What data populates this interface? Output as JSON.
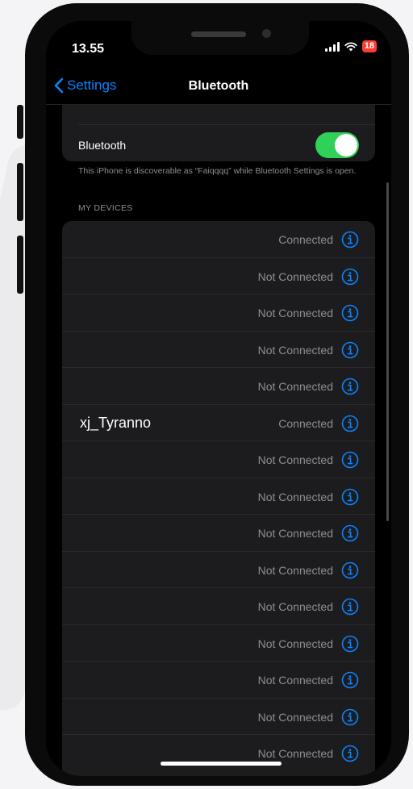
{
  "status_bar": {
    "time": "13.55",
    "battery_level": "18",
    "icons": [
      "signal-icon",
      "wifi-icon",
      "battery-icon"
    ]
  },
  "nav": {
    "back_label": "Settings",
    "title": "Bluetooth"
  },
  "bluetooth": {
    "label": "Bluetooth",
    "enabled": true,
    "description": "This iPhone is discoverable as “Faiqqqq” while Bluetooth Settings is open."
  },
  "my_devices": {
    "header": "MY DEVICES",
    "devices": [
      {
        "name": "",
        "status": "Connected"
      },
      {
        "name": "",
        "status": "Not Connected"
      },
      {
        "name": "",
        "status": "Not Connected"
      },
      {
        "name": "",
        "status": "Not Connected"
      },
      {
        "name": "",
        "status": "Not Connected"
      },
      {
        "name": "xj_Tyranno",
        "status": "Connected"
      },
      {
        "name": "",
        "status": "Not Connected"
      },
      {
        "name": "",
        "status": "Not Connected"
      },
      {
        "name": "",
        "status": "Not Connected"
      },
      {
        "name": "",
        "status": "Not Connected"
      },
      {
        "name": "",
        "status": "Not Connected"
      },
      {
        "name": "",
        "status": "Not Connected"
      },
      {
        "name": "",
        "status": "Not Connected"
      },
      {
        "name": "",
        "status": "Not Connected"
      },
      {
        "name": "",
        "status": "Not Connected"
      }
    ]
  },
  "colors": {
    "accent": "#0a84ff",
    "toggle_on": "#30d158",
    "battery_low": "#ff3b30",
    "cell_background": "#1c1c1e",
    "secondary_text": "#8e8e93"
  }
}
